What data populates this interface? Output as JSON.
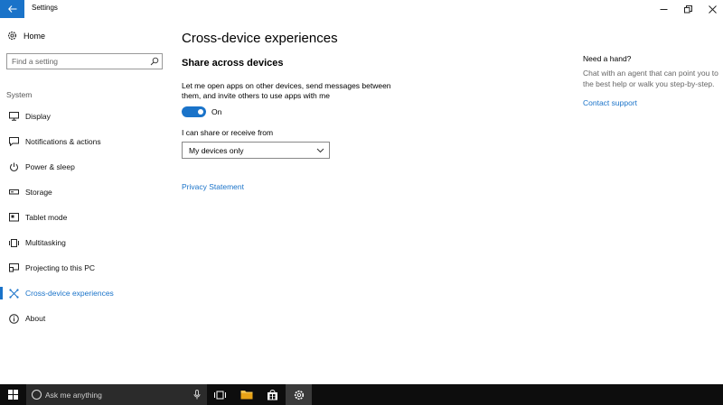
{
  "window": {
    "title": "Settings"
  },
  "sidebar": {
    "home_label": "Home",
    "search_placeholder": "Find a setting",
    "section_label": "System",
    "items": [
      {
        "label": "Display",
        "icon": "monitor-icon"
      },
      {
        "label": "Notifications & actions",
        "icon": "notification-icon"
      },
      {
        "label": "Power & sleep",
        "icon": "power-icon"
      },
      {
        "label": "Storage",
        "icon": "storage-icon"
      },
      {
        "label": "Tablet mode",
        "icon": "tablet-icon"
      },
      {
        "label": "Multitasking",
        "icon": "multitasking-icon"
      },
      {
        "label": "Projecting to this PC",
        "icon": "projector-icon"
      },
      {
        "label": "Cross-device experiences",
        "icon": "cross-device-icon",
        "active": true
      },
      {
        "label": "About",
        "icon": "info-icon"
      }
    ]
  },
  "main": {
    "title": "Cross-device experiences",
    "section_title": "Share across devices",
    "description": "Let me open apps on other devices, send messages between them, and invite others to use apps with me",
    "toggle": {
      "state_label": "On",
      "on": true
    },
    "share_label": "I can share or receive from",
    "share_value": "My devices only",
    "privacy_link": "Privacy Statement"
  },
  "help": {
    "title": "Need a hand?",
    "text": "Chat with an agent that can point you to the best help or walk you step-by-step.",
    "link": "Contact support"
  },
  "taskbar": {
    "search_text": "Ask me anything"
  },
  "colors": {
    "accent": "#1a73c9",
    "taskbar": "#0d0d0d"
  }
}
